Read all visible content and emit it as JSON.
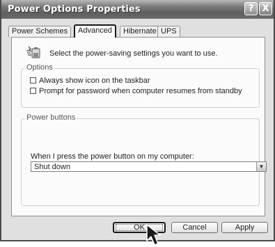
{
  "window": {
    "title": "Power Options Properties",
    "help_button": "?",
    "close_button": "X"
  },
  "tabs": [
    {
      "label": "Power Schemes",
      "active": false
    },
    {
      "label": "Advanced",
      "active": true
    },
    {
      "label": "Hibernate",
      "active": false
    },
    {
      "label": "UPS",
      "active": false
    }
  ],
  "advanced": {
    "icon": "battery-power-icon",
    "intro_text": "Select the power-saving settings you want to use.",
    "options_group": {
      "legend": "Options",
      "checkboxes": [
        {
          "label": "Always show icon on the taskbar",
          "checked": false
        },
        {
          "label": "Prompt for password when computer resumes from standby",
          "checked": false
        }
      ]
    },
    "power_buttons_group": {
      "legend": "Power buttons",
      "dropdown_label": "When I press the power button on my computer:",
      "dropdown_value": "Shut down"
    }
  },
  "buttons": {
    "ok": "OK",
    "cancel": "Cancel",
    "apply": "Apply"
  },
  "colors": {
    "titlebar": "#6a6a6a",
    "window_face": "#e0e0e0",
    "panel": "#fbfbfb",
    "highlight_outline": "#1a1a1a"
  },
  "pointer": "arrow-cursor-icon"
}
